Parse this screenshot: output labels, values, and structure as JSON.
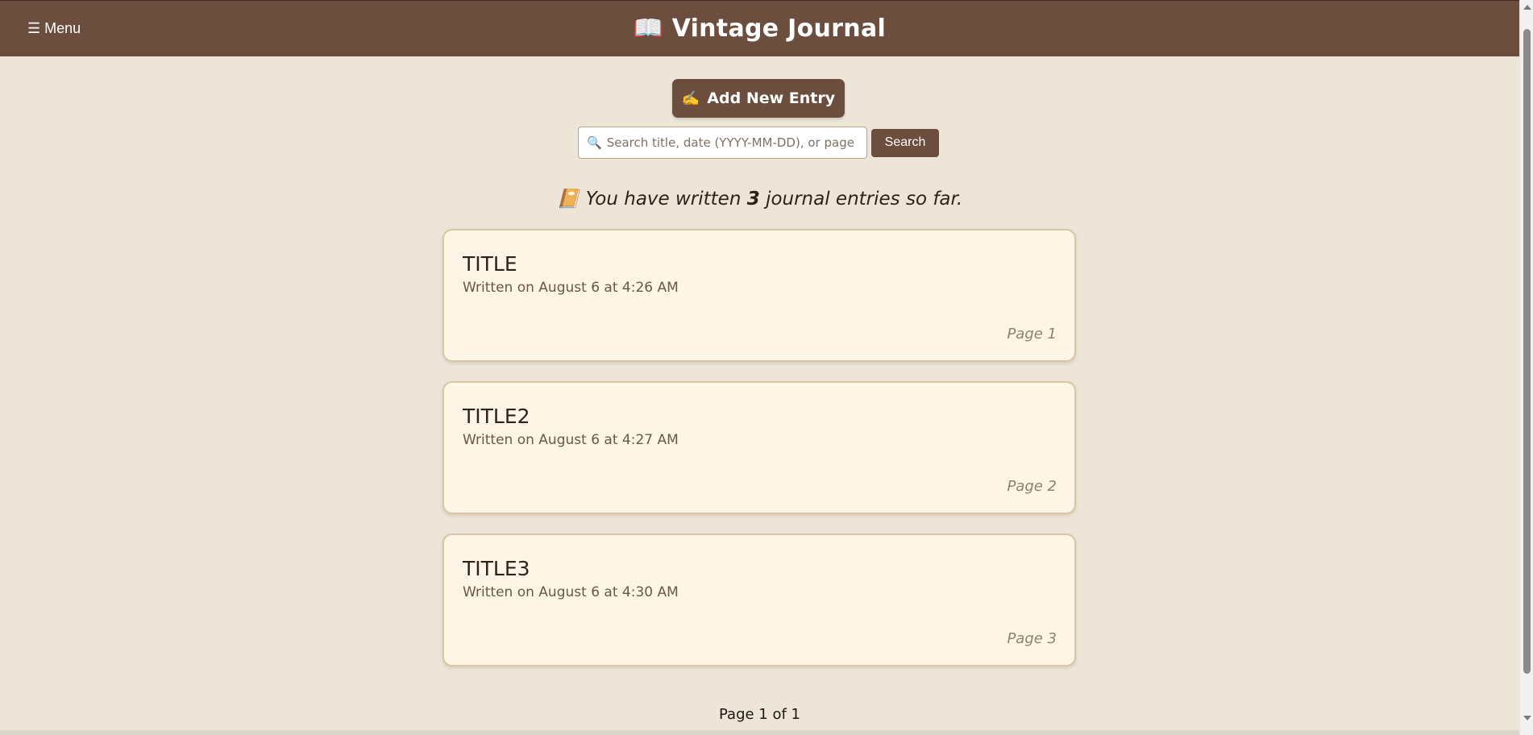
{
  "header": {
    "menu_label": "☰ Menu",
    "book_icon": "📖",
    "title": "Vintage Journal"
  },
  "toolbar": {
    "add_icon": "✍️",
    "add_label": "Add New Entry",
    "search_icon": "🔍",
    "search_placeholder": "Search title, date (YYYY-MM-DD), or page",
    "search_value": "",
    "search_button_label": "Search"
  },
  "summary": {
    "icon": "📔",
    "prefix": "You have written",
    "count": "3",
    "suffix": "journal entries so far."
  },
  "entries": [
    {
      "title": "TITLE",
      "date": "Written on August 6 at 4:26 AM",
      "page": "Page 1"
    },
    {
      "title": "TITLE2",
      "date": "Written on August 6 at 4:27 AM",
      "page": "Page 2"
    },
    {
      "title": "TITLE3",
      "date": "Written on August 6 at 4:30 AM",
      "page": "Page 3"
    }
  ],
  "pagination": {
    "label": "Page 1 of 1"
  },
  "colors": {
    "header_bg": "#6b4e3d",
    "page_bg": "#ede5d7",
    "card_bg": "#fdf6e6",
    "card_border": "#d8c6a6"
  }
}
